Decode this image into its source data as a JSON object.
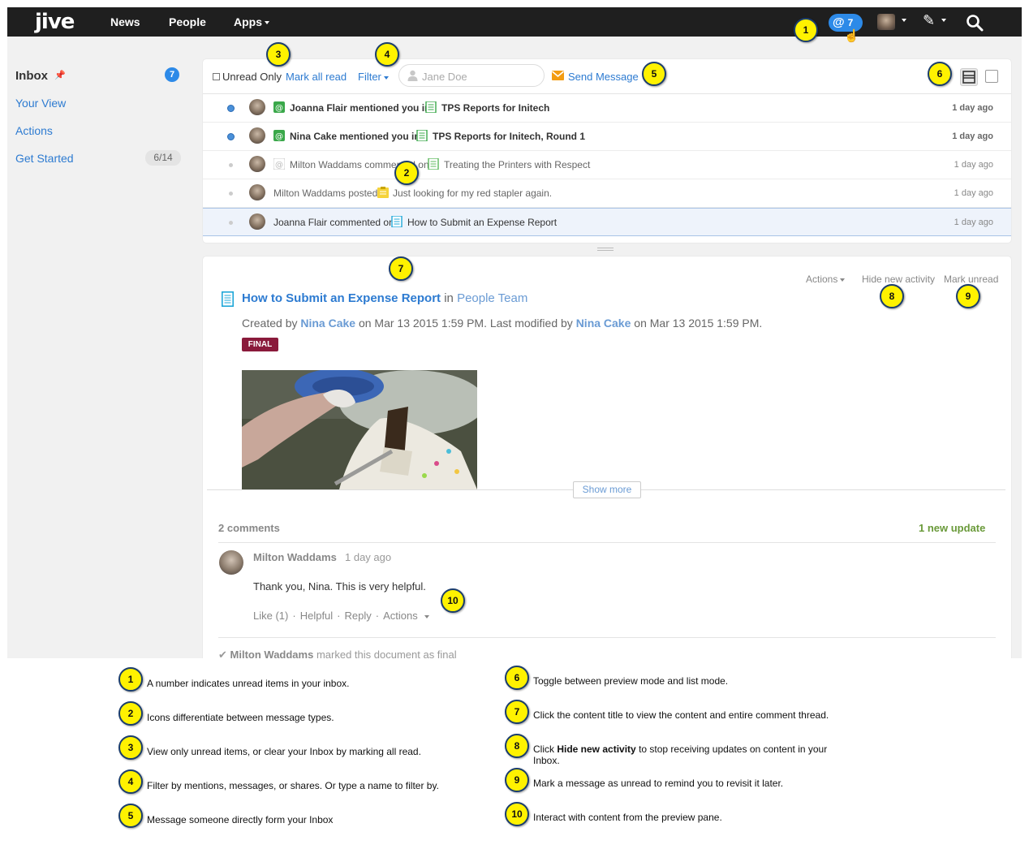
{
  "nav": {
    "logo": "jive",
    "news": "News",
    "people": "People",
    "apps": "Apps",
    "mention_at": "@",
    "mention_count": "7"
  },
  "sidebar": {
    "inbox": "Inbox",
    "inbox_count": "7",
    "your_view": "Your View",
    "actions": "Actions",
    "get_started": "Get Started",
    "get_started_progress": "6/14"
  },
  "toolbar": {
    "unread_only": "Unread Only",
    "mark_all_read": "Mark all read",
    "filter": "Filter",
    "search_placeholder": "Jane Doe",
    "send_message": "Send Message"
  },
  "rows": [
    {
      "segments": [
        "Joanna Flair mentioned you in",
        "TPS Reports for Initech"
      ],
      "time": "1 day ago",
      "unread": true
    },
    {
      "segments": [
        "Nina Cake mentioned you in",
        "TPS Reports for Initech, Round 1"
      ],
      "time": "1 day ago",
      "unread": true
    },
    {
      "segments": [
        "Milton Waddams commented on",
        "Treating the Printers with Respect"
      ],
      "time": "1 day ago",
      "unread": false
    },
    {
      "segments": [
        "Milton Waddams posted",
        "Just looking for my red stapler again."
      ],
      "time": "1 day ago",
      "unread": false
    },
    {
      "segments": [
        "Joanna Flair commented on",
        "How to Submit an Expense Report"
      ],
      "time": "1 day ago",
      "unread": false
    }
  ],
  "preview": {
    "actions": "Actions",
    "hide_new_activity": "Hide new activity",
    "mark_unread": "Mark unread",
    "title": "How to Submit an Expense Report",
    "in": "in",
    "place": "People Team",
    "meta": {
      "created_by": "Created by",
      "creator": "Nina Cake",
      "created_on": "on Mar 13 2015 1:59 PM. Last modified by",
      "modifier": "Nina Cake",
      "modified_on": "on Mar 13 2015 1:59 PM."
    },
    "badge": "FINAL",
    "show_more": "Show more",
    "comments_count": "2 comments",
    "new_update": "1 new update",
    "comment": {
      "author": "Milton Waddams",
      "time": "1 day ago",
      "body": "Thank you, Nina. This is very helpful.",
      "like": "Like (1)",
      "helpful": "Helpful",
      "reply": "Reply",
      "actions": "Actions"
    },
    "final_note_author": "Milton Waddams",
    "final_note_text": "marked this document as final"
  },
  "legend": [
    {
      "num": "1",
      "text": "A number indicates unread items in your inbox."
    },
    {
      "num": "2",
      "text": "Icons differentiate between message types."
    },
    {
      "num": "3",
      "text": "View only unread items, or clear your Inbox by marking all read."
    },
    {
      "num": "4",
      "text": "Filter by mentions, messages, or shares. Or type a name to filter by."
    },
    {
      "num": "5",
      "text": "Message someone directly form your Inbox"
    },
    {
      "num": "6",
      "text": "Toggle between preview mode and list mode."
    },
    {
      "num": "7",
      "text": "Click the content title to view the content and entire comment thread."
    },
    {
      "num": "8",
      "pre": "Click",
      "bold": "Hide new activity",
      "post": "to stop receiving updates on content in your",
      "post2": "Inbox."
    },
    {
      "num": "9",
      "text": "Mark a message as unread to remind you to revisit it later."
    },
    {
      "num": "10",
      "text": "Interact with content from the preview pane."
    }
  ],
  "colors": {
    "link": "#2d7bd1",
    "badge_blue": "#2d8ae8",
    "callout_yellow": "#fff200",
    "final_badge": "#8a1a3b",
    "update_green": "#6a9a3a"
  }
}
